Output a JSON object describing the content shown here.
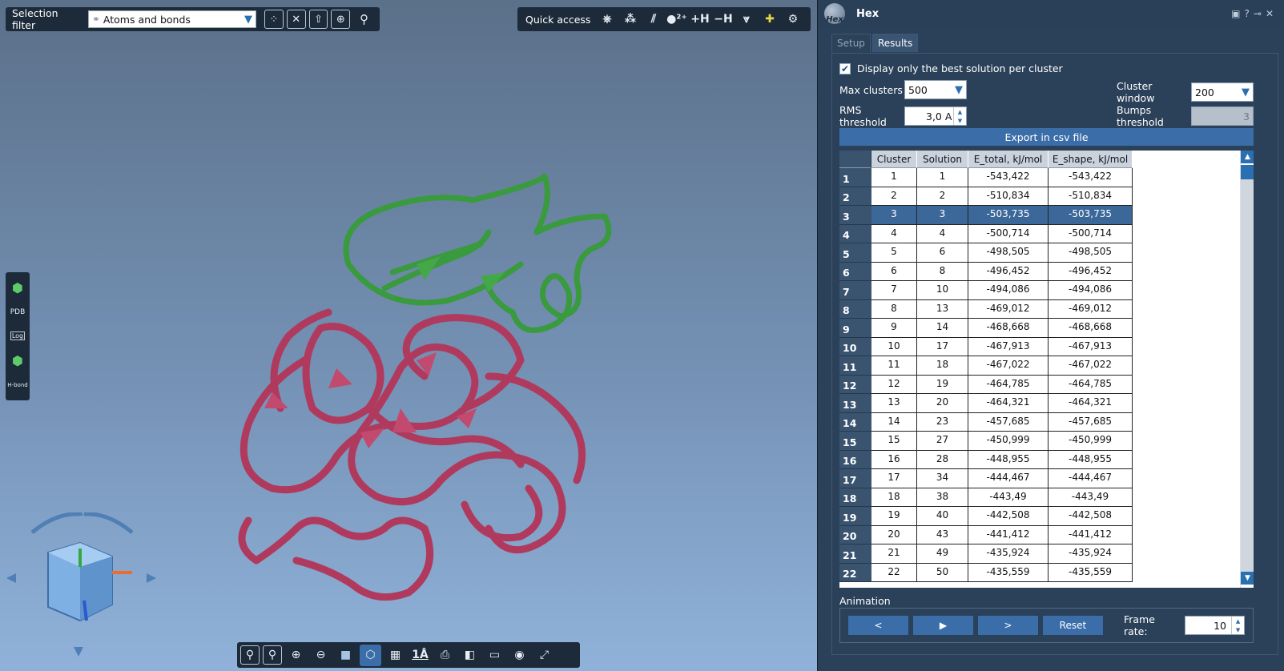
{
  "toolbar": {
    "selection_filter_label": "Selection filter",
    "selection_filter_value": "Atoms and bonds",
    "quick_access_label": "Quick access",
    "add_h_label": "+H",
    "remove_h_label": "−H"
  },
  "left_toolbar": {
    "pdb_label": "PDB",
    "log_label": "Log",
    "hbond_label": "H-bond"
  },
  "bottom_toolbar": {
    "distance_label": "1Å"
  },
  "panel": {
    "title": "Hex",
    "logo_text": "Hex",
    "tabs": [
      "Setup",
      "Results"
    ],
    "active_tab": "Results",
    "best_solution_label": "Display only the best solution per cluster",
    "best_solution_checked": true,
    "max_clusters_label": "Max clusters",
    "max_clusters_value": "500",
    "cluster_window_label": "Cluster window",
    "cluster_window_value": "200",
    "rms_threshold_label": "RMS threshold",
    "rms_threshold_value": "3,0 A",
    "bumps_threshold_label": "Bumps threshold",
    "bumps_threshold_value": "3",
    "export_label": "Export in csv file",
    "animation_label": "Animation",
    "anim_prev": "<",
    "anim_play": "▶",
    "anim_next": ">",
    "anim_reset": "Reset",
    "frame_rate_label": "Frame rate:",
    "frame_rate_value": "10"
  },
  "table": {
    "columns": [
      "Cluster",
      "Solution",
      "E_total, kJ/mol",
      "E_shape, kJ/mol"
    ],
    "selected_row": 3,
    "rows": [
      [
        "1",
        "1",
        "1",
        "-543,422",
        "-543,422"
      ],
      [
        "2",
        "2",
        "2",
        "-510,834",
        "-510,834"
      ],
      [
        "3",
        "3",
        "3",
        "-503,735",
        "-503,735"
      ],
      [
        "4",
        "4",
        "4",
        "-500,714",
        "-500,714"
      ],
      [
        "5",
        "5",
        "6",
        "-498,505",
        "-498,505"
      ],
      [
        "6",
        "6",
        "8",
        "-496,452",
        "-496,452"
      ],
      [
        "7",
        "7",
        "10",
        "-494,086",
        "-494,086"
      ],
      [
        "8",
        "8",
        "13",
        "-469,012",
        "-469,012"
      ],
      [
        "9",
        "9",
        "14",
        "-468,668",
        "-468,668"
      ],
      [
        "10",
        "10",
        "17",
        "-467,913",
        "-467,913"
      ],
      [
        "11",
        "11",
        "18",
        "-467,022",
        "-467,022"
      ],
      [
        "12",
        "12",
        "19",
        "-464,785",
        "-464,785"
      ],
      [
        "13",
        "13",
        "20",
        "-464,321",
        "-464,321"
      ],
      [
        "14",
        "14",
        "23",
        "-457,685",
        "-457,685"
      ],
      [
        "15",
        "15",
        "27",
        "-450,999",
        "-450,999"
      ],
      [
        "16",
        "16",
        "28",
        "-448,955",
        "-448,955"
      ],
      [
        "17",
        "17",
        "34",
        "-444,467",
        "-444,467"
      ],
      [
        "18",
        "18",
        "38",
        "-443,49",
        "-443,49"
      ],
      [
        "19",
        "19",
        "40",
        "-442,508",
        "-442,508"
      ],
      [
        "20",
        "20",
        "43",
        "-441,412",
        "-441,412"
      ],
      [
        "21",
        "21",
        "49",
        "-435,924",
        "-435,924"
      ],
      [
        "22",
        "22",
        "50",
        "-435,559",
        "-435,559"
      ]
    ]
  },
  "colors": {
    "viewport_top": "#5b7089",
    "viewport_bottom": "#90b2da",
    "ligand": "#3a9a3e",
    "receptor": "#b03a5e",
    "selection": "#3c6899",
    "accent": "#2a6fb0"
  }
}
